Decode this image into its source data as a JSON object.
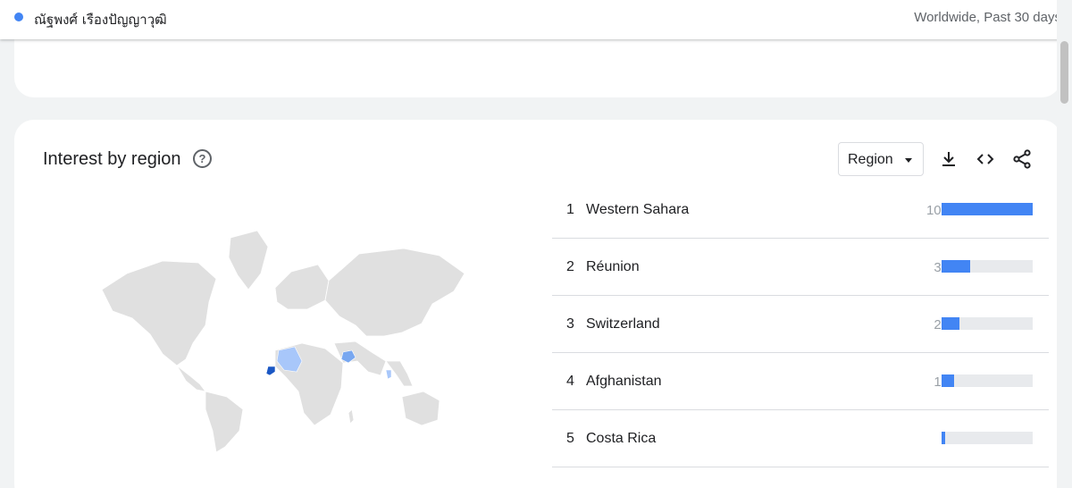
{
  "header": {
    "search_term": "ณัฐพงศ์ เรืองปัญญาวุฒิ",
    "scope": "Worldwide, Past 30 days",
    "series_color": "#4285f4"
  },
  "region_card": {
    "title": "Interest by region",
    "help_icon": "help-circle-icon",
    "dropdown_value": "Region",
    "toolbar_icons": [
      "download-icon",
      "embed-code-icon",
      "share-icon"
    ],
    "highlighted_regions": [
      "Western Sahara",
      "Algeria",
      "Afghanistan",
      "Thailand"
    ],
    "rows": [
      {
        "rank": "1",
        "name": "Western Sahara",
        "value": "100",
        "fraction": 1.0
      },
      {
        "rank": "2",
        "name": "Réunion",
        "value": "31",
        "fraction": 0.31
      },
      {
        "rank": "3",
        "name": "Switzerland",
        "value": "20",
        "fraction": 0.2
      },
      {
        "rank": "4",
        "name": "Afghanistan",
        "value": "14",
        "fraction": 0.14
      },
      {
        "rank": "5",
        "name": "Costa Rica",
        "value": "4",
        "fraction": 0.04
      }
    ]
  }
}
